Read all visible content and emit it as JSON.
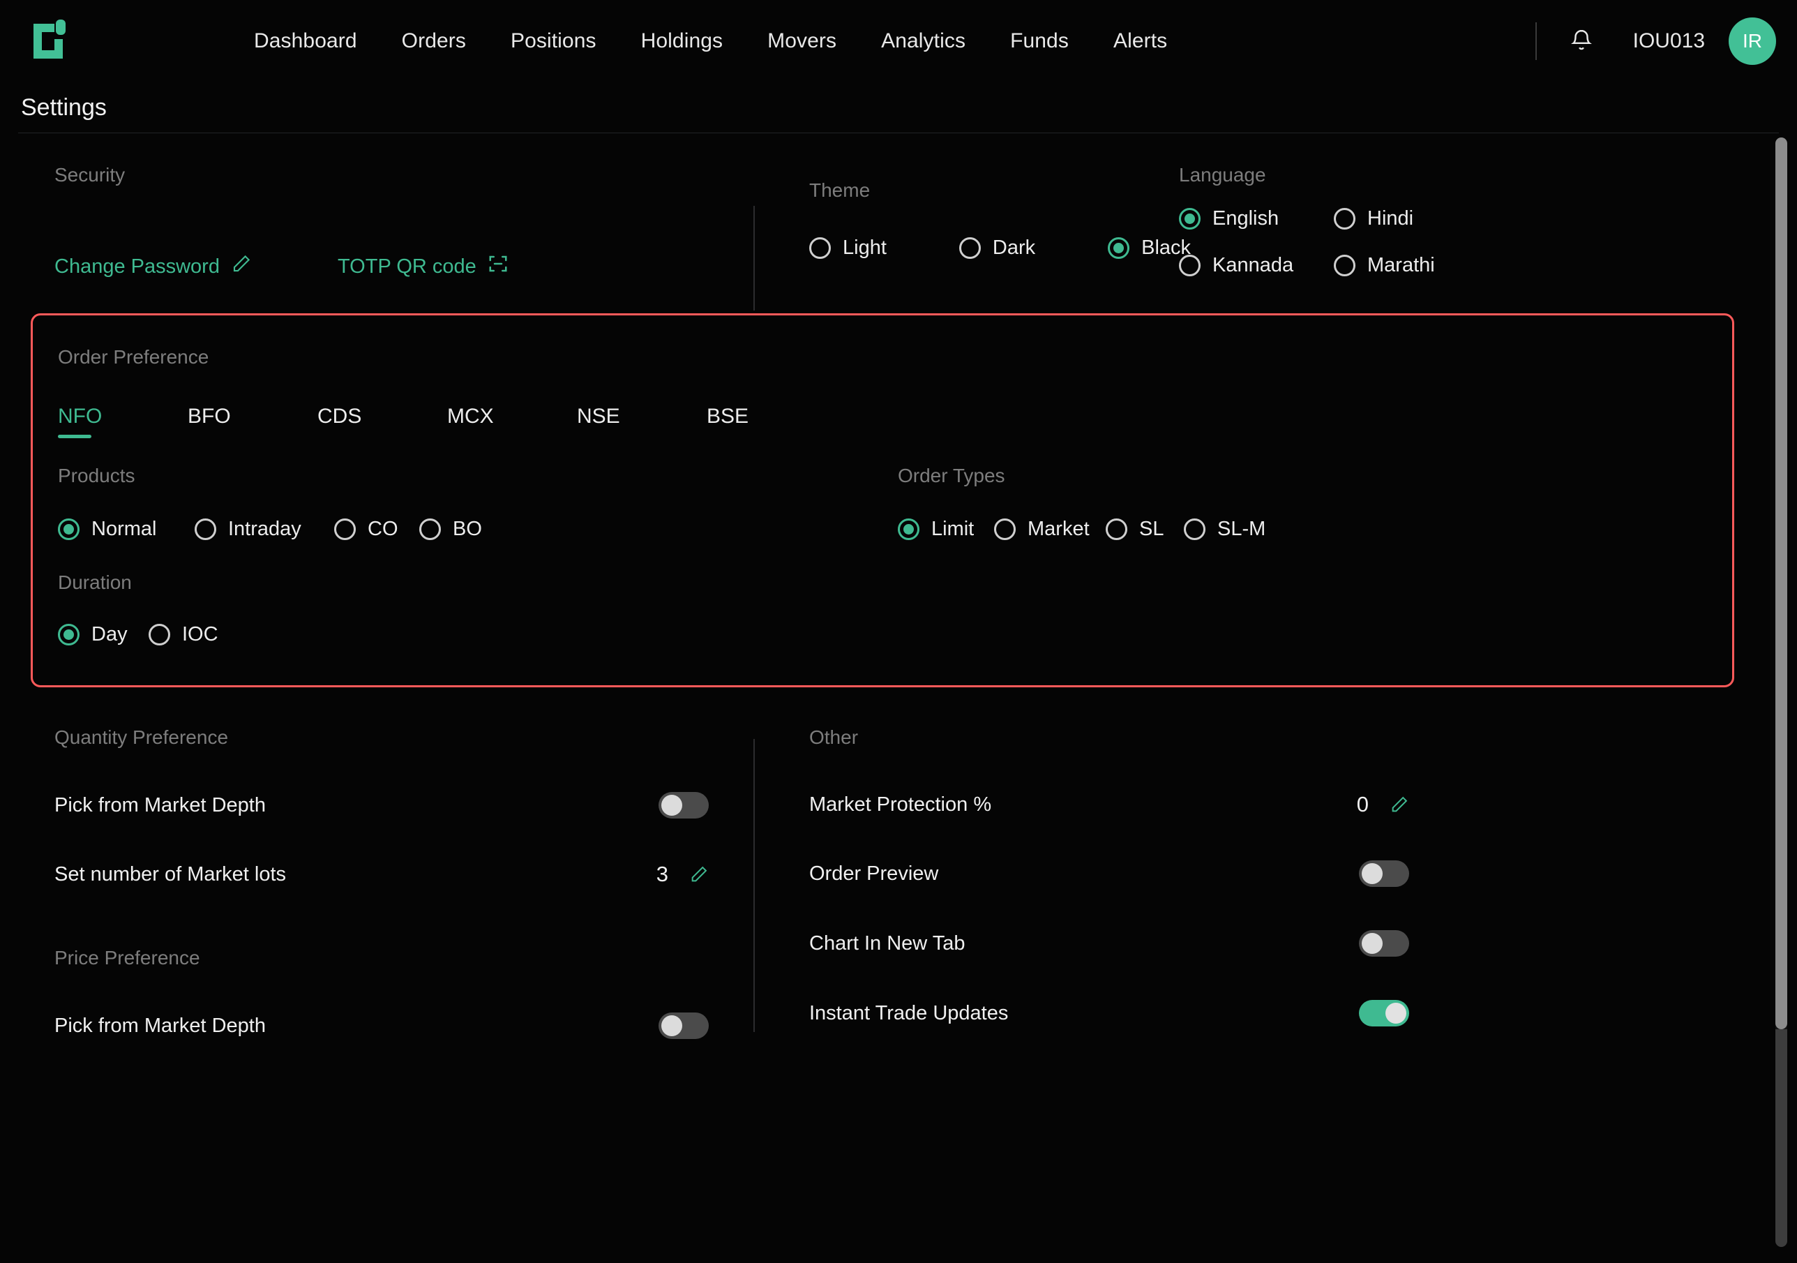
{
  "app": {
    "logo_icon": "app-logo-icon",
    "accent_green": "#3fba91",
    "highlight_red": "#ff5a5a",
    "background": "#050505"
  },
  "topnav": {
    "items": [
      {
        "label": "Dashboard"
      },
      {
        "label": "Orders"
      },
      {
        "label": "Positions"
      },
      {
        "label": "Holdings"
      },
      {
        "label": "Movers"
      },
      {
        "label": "Analytics"
      },
      {
        "label": "Funds"
      },
      {
        "label": "Alerts"
      }
    ],
    "notification_icon": "bell-icon",
    "user_id": "IOU013",
    "avatar_initials": "IR"
  },
  "page": {
    "title": "Settings"
  },
  "security": {
    "label": "Security",
    "change_password": "Change Password",
    "change_password_icon": "pencil-icon",
    "totp_qr": "TOTP QR code",
    "totp_qr_icon": "qr-scan-icon"
  },
  "theme": {
    "label": "Theme",
    "options": [
      {
        "label": "Light",
        "selected": false
      },
      {
        "label": "Dark",
        "selected": false
      },
      {
        "label": "Black",
        "selected": true
      }
    ]
  },
  "language": {
    "label": "Language",
    "options": [
      {
        "label": "English",
        "selected": true
      },
      {
        "label": "Hindi",
        "selected": false
      },
      {
        "label": "Kannada",
        "selected": false
      },
      {
        "label": "Marathi",
        "selected": false
      }
    ]
  },
  "order_preference": {
    "label": "Order Preference",
    "highlighted": true,
    "tabs": [
      {
        "label": "NFO",
        "active": true
      },
      {
        "label": "BFO",
        "active": false
      },
      {
        "label": "CDS",
        "active": false
      },
      {
        "label": "MCX",
        "active": false
      },
      {
        "label": "NSE",
        "active": false
      },
      {
        "label": "BSE",
        "active": false
      }
    ],
    "products": {
      "label": "Products",
      "options": [
        {
          "label": "Normal",
          "selected": true
        },
        {
          "label": "Intraday",
          "selected": false
        },
        {
          "label": "CO",
          "selected": false
        },
        {
          "label": "BO",
          "selected": false
        }
      ]
    },
    "order_types": {
      "label": "Order Types",
      "options": [
        {
          "label": "Limit",
          "selected": true
        },
        {
          "label": "Market",
          "selected": false
        },
        {
          "label": "SL",
          "selected": false
        },
        {
          "label": "SL-M",
          "selected": false
        }
      ]
    },
    "duration": {
      "label": "Duration",
      "options": [
        {
          "label": "Day",
          "selected": true
        },
        {
          "label": "IOC",
          "selected": false
        }
      ]
    }
  },
  "quantity_preference": {
    "label": "Quantity Preference",
    "pick_from_market_depth": {
      "label": "Pick from Market Depth",
      "on": false
    },
    "market_lots": {
      "label": "Set number of Market lots",
      "value": "3",
      "edit_icon": "pencil-icon"
    }
  },
  "price_preference": {
    "label": "Price Preference",
    "pick_from_market_depth": {
      "label": "Pick from Market Depth",
      "on": false
    }
  },
  "other": {
    "label": "Other",
    "market_protection": {
      "label": "Market Protection %",
      "value": "0",
      "edit_icon": "pencil-icon"
    },
    "order_preview": {
      "label": "Order Preview",
      "on": false
    },
    "chart_in_new_tab": {
      "label": "Chart In New Tab",
      "on": false
    },
    "instant_trade_updates": {
      "label": "Instant Trade Updates",
      "on": true
    }
  }
}
